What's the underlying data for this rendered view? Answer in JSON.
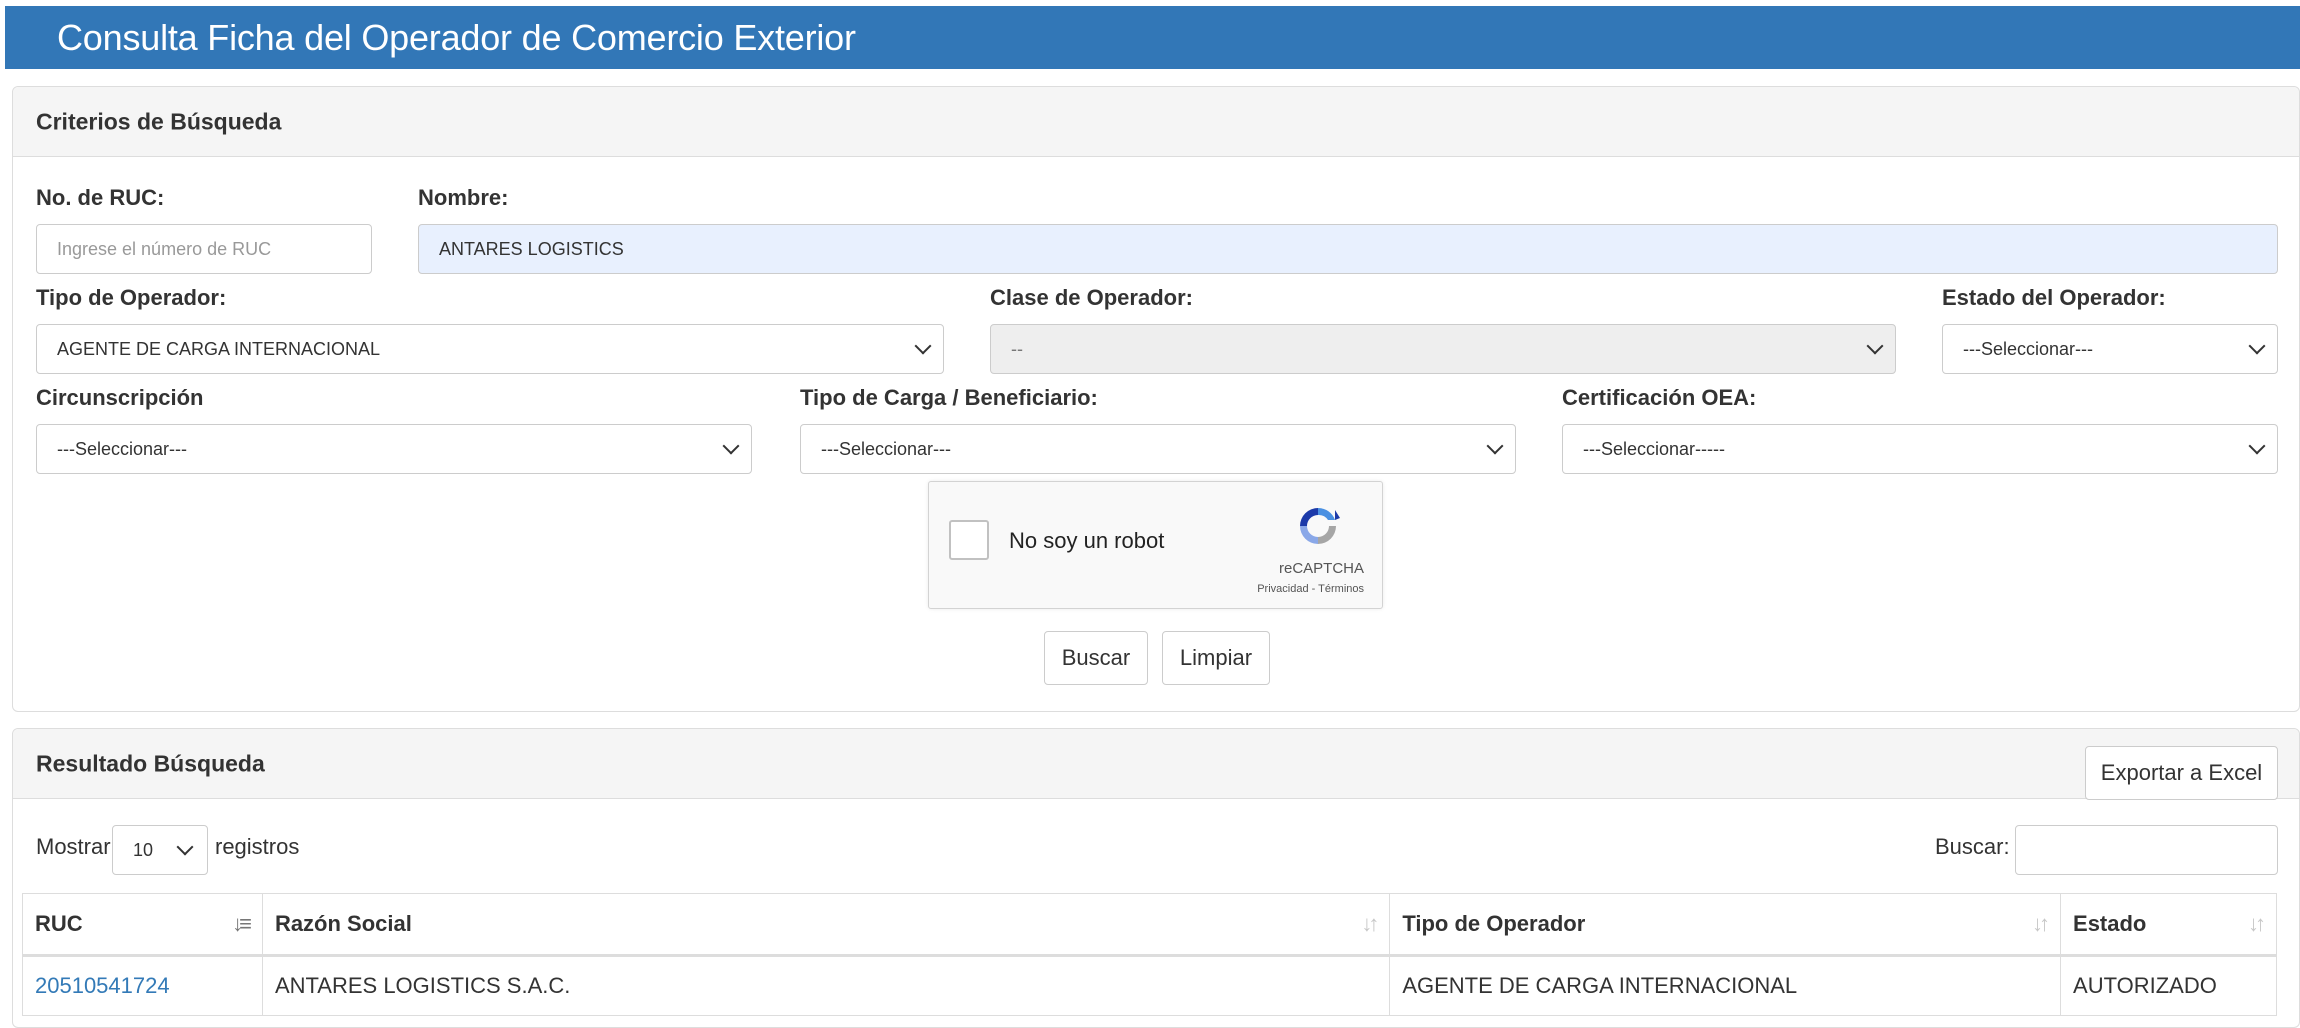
{
  "header": {
    "title": "Consulta Ficha del Operador de Comercio Exterior"
  },
  "criteria": {
    "title": "Criterios de Búsqueda",
    "ruc": {
      "label": "No. de RUC:",
      "value": "",
      "placeholder": "Ingrese el número de RUC"
    },
    "nombre": {
      "label": "Nombre:",
      "value": "ANTARES LOGISTICS"
    },
    "tipo_operador": {
      "label": "Tipo de Operador:",
      "selected": "AGENTE DE CARGA INTERNACIONAL"
    },
    "clase_operador": {
      "label": "Clase de Operador:",
      "selected": "--"
    },
    "estado_operador": {
      "label": "Estado del Operador:",
      "selected": "---Seleccionar---"
    },
    "circunscripcion": {
      "label": "Circunscripción",
      "selected": "---Seleccionar---"
    },
    "tipo_carga": {
      "label": "Tipo de Carga / Beneficiario:",
      "selected": "---Seleccionar---"
    },
    "certificacion": {
      "label": "Certificación OEA:",
      "selected": "---Seleccionar-----"
    },
    "captcha": {
      "label": "No soy un robot",
      "brand": "reCAPTCHA",
      "terms": "Privacidad - Términos"
    },
    "buttons": {
      "search": "Buscar",
      "clear": "Limpiar"
    }
  },
  "results": {
    "title": "Resultado Búsqueda",
    "export_label": "Exportar a Excel",
    "show_label": "Mostrar",
    "page_size": "10",
    "records_label": "registros",
    "search_label": "Buscar:",
    "columns": [
      "RUC",
      "Razón Social",
      "Tipo de Operador",
      "Estado"
    ],
    "rows": [
      [
        "20510541724",
        "ANTARES LOGISTICS S.A.C.",
        "AGENTE DE CARGA INTERNACIONAL",
        "AUTORIZADO"
      ]
    ]
  }
}
